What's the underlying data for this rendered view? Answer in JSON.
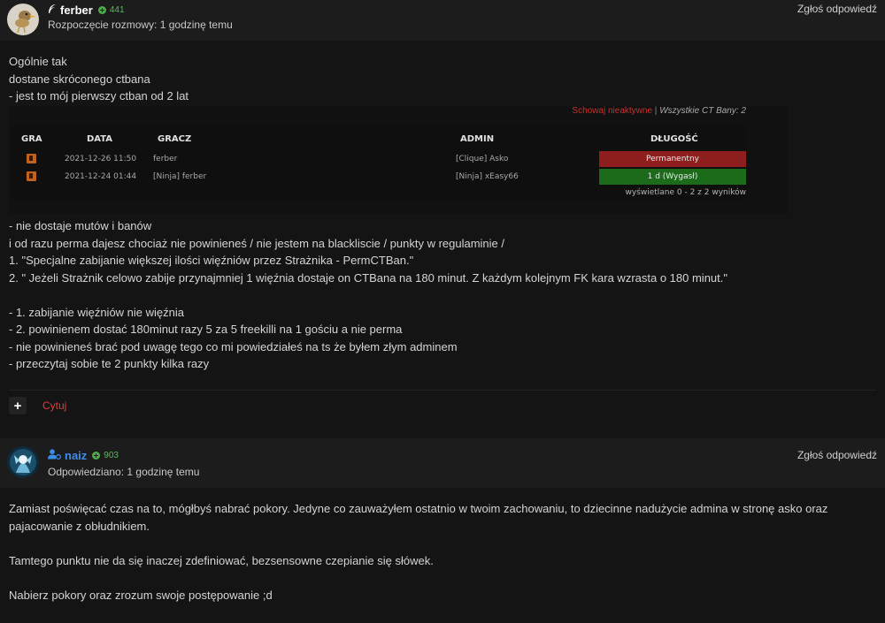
{
  "posts": [
    {
      "author": {
        "name": "ferber",
        "reputation": "441",
        "name_color": "#ffffff",
        "avatar_icon": "bird-avatar-icon",
        "role_icon": "feather-icon"
      },
      "meta": "Rozpoczęcie rozmowy: 1 godzinę temu",
      "report_label": "Zgłoś odpowiedź",
      "intro_lines": [
        "Ogólnie tak",
        "dostane skróconego ctbana",
        "- jest to mój pierwszy ctban od 2 lat"
      ],
      "embed": {
        "hide_inactive": "Schowaj nieaktywne",
        "separator": " | ",
        "all_bans": "Wszystkie CT Bany: 2",
        "headers": {
          "game": "GRA",
          "date": "DATA",
          "player": "GRACZ",
          "admin": "ADMIN",
          "length": "DŁUGOŚĆ"
        },
        "rows": [
          {
            "game_icon": "cs-game-icon",
            "date": "2021-12-26 11:50",
            "player": "ferber",
            "admin": "[Clique] Asko",
            "length": "Permanentny",
            "length_color": "#8f1e1e"
          },
          {
            "game_icon": "cs-game-icon",
            "date": "2021-12-24 01:44",
            "player": "[Ninja] ferber",
            "admin": "[Ninja] xEasy66",
            "length": "1 d (Wygasł)",
            "length_color": "#1b6b1b"
          }
        ],
        "results": "wyświetlane 0 - 2 z 2 wyników"
      },
      "body_lines": [
        "- nie dostaje mutów i banów",
        "i od razu perma dajesz chociaż nie powinieneś / nie jestem na blackliscie / punkty w regulaminie /",
        "1. \"Specjalne zabijanie większej ilości więźniów przez Strażnika - PermCTBan.\"",
        "2. \" Jeżeli Strażnik celowo zabije przynajmniej 1 więźnia dostaje on CTBana na 180 minut. Z każdym kolejnym FK kara wzrasta o 180 minut.\"",
        "",
        "- 1. zabijanie więźniów nie więźnia",
        "- 2. powinienem dostać 180minut razy 5 za 5 freekilli na 1 gościu a nie perma",
        "- nie powinieneś brać pod uwagę tego co mi powiedziałeś na ts że byłem złym adminem",
        "- przeczytaj sobie te 2 punkty kilka razy"
      ],
      "plus_label": "+",
      "quote_label": "Cytuj"
    },
    {
      "author": {
        "name": "naiz",
        "reputation": "903",
        "name_color": "#3d8ee8",
        "avatar_icon": "character-avatar-icon",
        "role_icon": "user-cog-icon"
      },
      "meta": "Odpowiedziano: 1 godzinę temu",
      "report_label": "Zgłoś odpowiedź",
      "paragraphs": [
        "Zamiast poświęcać czas na to, mógłbyś nabrać pokory. Jedyne co zauważyłem ostatnio w twoim zachowaniu, to dziecinne nadużycie admina w stronę asko oraz pajacowanie z obłudnikiem.",
        "Tamtego punktu nie da się inaczej zdefiniować, bezsensowne czepianie się słówek.",
        "Nabierz pokory oraz zrozum swoje postępowanie ;d"
      ]
    }
  ]
}
